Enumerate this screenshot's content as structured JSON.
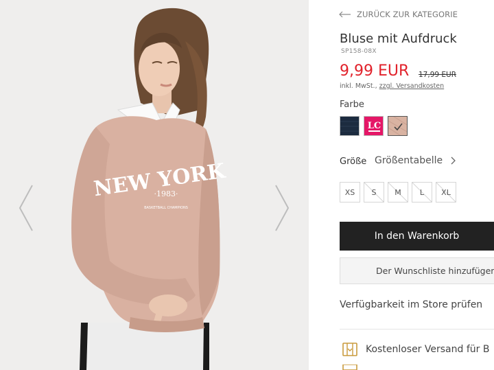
{
  "gallery": {
    "print_title": "NEW YORK",
    "print_year": "·1983·",
    "print_subtitle": "BASKETBALL CHAMPIONS"
  },
  "product": {
    "back_label": "ZURÜCK ZUR KATEGORIE",
    "title": "Bluse mit Aufdruck",
    "sku": "SP158-08X",
    "price": "9,99 EUR",
    "old_price": "17,99 EUR",
    "tax_note": "inkl. MwSt.,",
    "shipping_cost_link": "zzgl. Versandkosten",
    "color_label": "Farbe",
    "colors": [
      {
        "name": "navy",
        "hex": "#1c2b3f"
      },
      {
        "name": "pink",
        "hex": "#e51767",
        "print": "LC"
      },
      {
        "name": "rose",
        "hex": "#d9b3a2",
        "selected": true
      }
    ],
    "size_label": "Größe",
    "size_chart_label": "Größentabelle",
    "sizes": [
      {
        "label": "XS",
        "available": true
      },
      {
        "label": "S",
        "available": false
      },
      {
        "label": "M",
        "available": false
      },
      {
        "label": "L",
        "available": false
      },
      {
        "label": "XL",
        "available": false
      }
    ],
    "add_to_cart": "In den Warenkorb",
    "wishlist": "Der Wunschliste hinzufügen",
    "store_availability": "Verfügbarkeit im Store prüfen",
    "free_shipping": "Kostenloser Versand für B"
  },
  "colors": {
    "price_red": "#e1222b",
    "button_dark": "#222222",
    "icon_gold": "#c99a3b"
  }
}
